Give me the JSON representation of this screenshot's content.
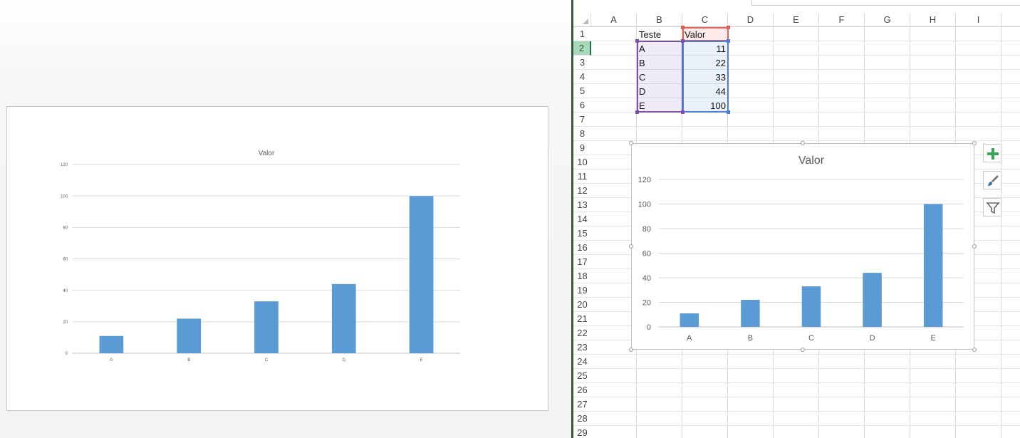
{
  "slide_chart": {
    "chart_data": {
      "type": "bar",
      "title": "Valor",
      "categories": [
        "A",
        "B",
        "C",
        "D",
        "E"
      ],
      "values": [
        11,
        22,
        33,
        44,
        100
      ],
      "ylim": [
        0,
        120
      ],
      "yticks": [
        0,
        20,
        40,
        60,
        80,
        100,
        120
      ],
      "grid": true,
      "bar_color": "#5b9bd5"
    }
  },
  "spreadsheet": {
    "columns": [
      "A",
      "B",
      "C",
      "D",
      "E",
      "F",
      "G",
      "H",
      "I"
    ],
    "rows": [
      "1",
      "2",
      "3",
      "4",
      "5",
      "6",
      "7",
      "8",
      "9",
      "10",
      "11",
      "12",
      "13",
      "14",
      "15",
      "16",
      "17",
      "18",
      "19",
      "20",
      "21",
      "22",
      "23",
      "24",
      "25",
      "26",
      "27",
      "28",
      "29"
    ],
    "active_row": "2",
    "header_row": {
      "B": "Teste",
      "C": "Valor"
    },
    "data_rows": [
      {
        "B": "A",
        "C": "11"
      },
      {
        "B": "B",
        "C": "22"
      },
      {
        "B": "C",
        "C": "33"
      },
      {
        "B": "D",
        "C": "44"
      },
      {
        "B": "E",
        "C": "100"
      }
    ],
    "selection_colors": {
      "categories": "#7f4fb0",
      "values": "#4a7fe0",
      "series_name": "#e06055"
    }
  },
  "embedded_chart": {
    "chart_data": {
      "type": "bar",
      "title": "Valor",
      "categories": [
        "A",
        "B",
        "C",
        "D",
        "E"
      ],
      "values": [
        11,
        22,
        33,
        44,
        100
      ],
      "ylim": [
        0,
        120
      ],
      "yticks": [
        0,
        20,
        40,
        60,
        80,
        100,
        120
      ],
      "grid": true,
      "bar_color": "#5b9bd5"
    }
  },
  "chart_tools": [
    {
      "name": "chart-elements-button",
      "icon": "plus-icon",
      "color": "#3fa060"
    },
    {
      "name": "chart-styles-button",
      "icon": "brush-icon",
      "color": "#3a6fc0"
    },
    {
      "name": "chart-filters-button",
      "icon": "funnel-icon",
      "color": "#666666"
    }
  ]
}
